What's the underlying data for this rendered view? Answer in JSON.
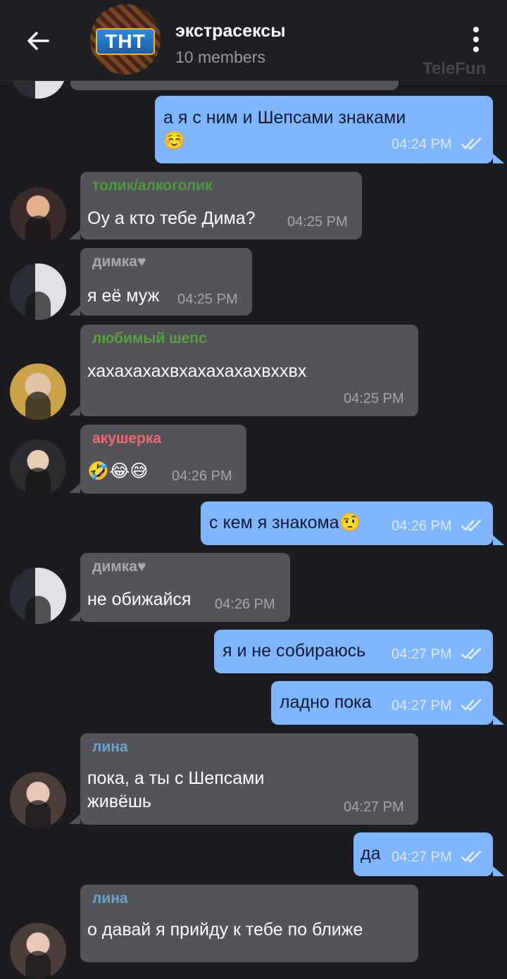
{
  "header": {
    "back_icon": "arrow-left-icon",
    "group_avatar_text": "ТНТ",
    "title": "экстрасексы",
    "members": "10 members",
    "more_icon": "more-vertical-icon",
    "watermark": "TeleFun"
  },
  "colors": {
    "background": "#1c1b20",
    "incoming_bubble": "#54535a",
    "outgoing_bubble": "#7fb6ff",
    "name_tolik": "#4f9a3e",
    "name_dimka": "#a9a8ad",
    "name_shepps": "#57a23e",
    "name_akush": "#e86d73",
    "name_lina": "#6aa4cd"
  },
  "messages": [
    {
      "from": "me",
      "text": "а я с ним и Шепсами знаками\n☺️",
      "time": "04:24 PM",
      "status": "read"
    },
    {
      "from": "толик/алкоголик",
      "text": "Оу а кто тебе Дима?",
      "time": "04:25 PM"
    },
    {
      "from": "димка♥",
      "text": "я её муж",
      "time": "04:25 PM"
    },
    {
      "from": "любимый шепс",
      "text": "хахахахахвхахахахахвххвх",
      "time": "04:25 PM"
    },
    {
      "from": "акушерка",
      "text": "🤣😂😅",
      "time": "04:26 PM"
    },
    {
      "from": "me",
      "text": "с кем я знакома🤨",
      "time": "04:26 PM",
      "status": "read"
    },
    {
      "from": "димка♥",
      "text": "не обижайся",
      "time": "04:26 PM"
    },
    {
      "from": "me",
      "text": "я и не собираюсь",
      "time": "04:27 PM",
      "status": "read"
    },
    {
      "from": "me",
      "text": "ладно пока",
      "time": "04:27 PM",
      "status": "read"
    },
    {
      "from": "лина",
      "text": "пока, а ты с Шепсами\nживёшь",
      "time": "04:27 PM"
    },
    {
      "from": "me",
      "text": "да",
      "time": "04:27 PM",
      "status": "read"
    },
    {
      "from": "лина",
      "text": "о давай я прийду к тебе по ближе",
      "time": ""
    }
  ]
}
